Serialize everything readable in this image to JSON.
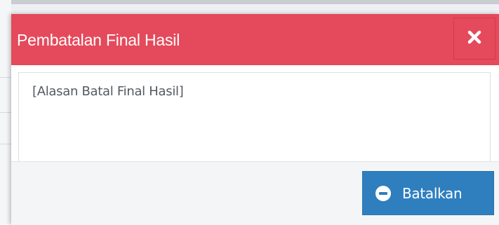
{
  "modal": {
    "title": "Pembatalan Final Hasil",
    "close_icon": "close-icon",
    "reason_placeholder": "[Alasan Batal Final Hasil]",
    "cancel_button": {
      "label": "Batalkan",
      "icon": "minus-circle-icon"
    }
  },
  "colors": {
    "header": "#e44a5b",
    "button": "#2f7fbf",
    "footer": "#f4f5f7"
  }
}
